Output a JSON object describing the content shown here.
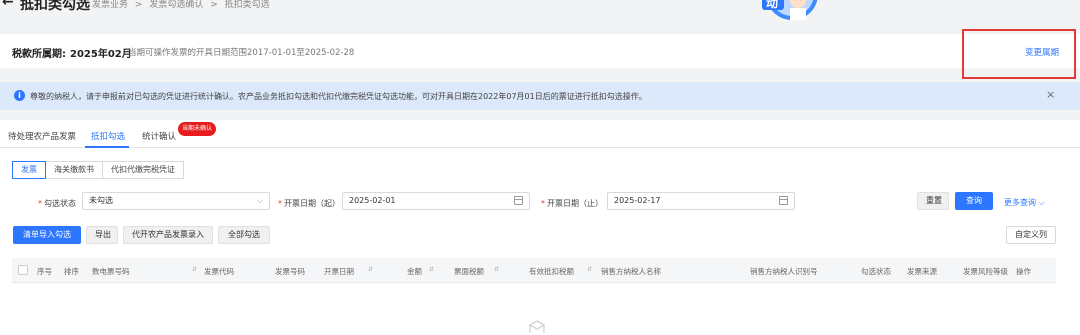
{
  "header": {
    "back_icon": "←",
    "title": "抵扣类勾选",
    "breadcrumbs": [
      "发票业务",
      ">",
      "发票勾选确认",
      ">",
      "抵扣类勾选"
    ]
  },
  "period": {
    "label": "税款所属期:",
    "value": "2025年02月",
    "range_text": "当期可操作发票的开具日期范围2017-01-01至2025-02-28",
    "change_link": "变更属期"
  },
  "notice": {
    "icon": "i",
    "text": "尊敬的纳税人，请于申报前对已勾选的凭证进行统计确认。农产品业务抵扣勾选和代扣代缴完税凭证勾选功能，可对开具日期在2022年07月01日后的票证进行抵扣勾选操作。",
    "close": "×"
  },
  "tabs": [
    {
      "label": "待处理农产品发票"
    },
    {
      "label": "抵扣勾选"
    },
    {
      "label": "统计确认"
    }
  ],
  "tab_badge": "当期未确认",
  "subtabs": [
    {
      "label": "发票"
    },
    {
      "label": "海关缴款书"
    },
    {
      "label": "代扣代缴完税凭证"
    }
  ],
  "filters": {
    "status_label": "勾选状态",
    "status_value": "未勾选",
    "status_arrow": "⌵",
    "date_from_label": "开票日期（起）",
    "date_from_value": "2025-02-01",
    "date_to_label": "开票日期（止）",
    "date_to_value": "2025-02-17",
    "required_mark": "*"
  },
  "actions": {
    "reset": "重置",
    "query": "查询",
    "more_query": "更多查询 ⌵",
    "import": "清单导入勾选",
    "export": "导出",
    "agri_entry": "代开农产品发票录入",
    "select_all": "全部勾选",
    "custom_columns": "自定义列"
  },
  "table": {
    "columns": [
      "序号",
      "排序",
      "数电票号码",
      "发票代码",
      "发票号码",
      "开票日期",
      "金额",
      "票面税额",
      "有效抵扣税额",
      "销售方纳税人名称",
      "销售方纳税人识别号",
      "勾选状态",
      "发票来源",
      "发票风险等级",
      "操作"
    ],
    "sort_icon": "⇵"
  },
  "colors": {
    "accent": "#2d76ff",
    "badge_red": "#e81c1c",
    "highlight_box": "#e53935",
    "notice_bg": "#dbe9fb"
  }
}
